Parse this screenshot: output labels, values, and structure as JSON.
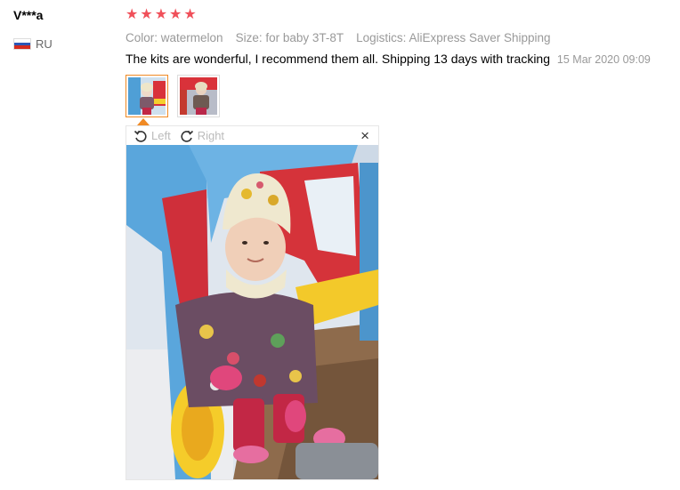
{
  "reviewer": {
    "name": "V***a",
    "country": "RU",
    "flag_icon": "russia-flag-icon"
  },
  "review": {
    "rating": 5,
    "stars": [
      "★",
      "★",
      "★",
      "★",
      "★"
    ],
    "attributes": [
      {
        "key": "Color:",
        "value": "watermelon"
      },
      {
        "key": "Size:",
        "value": "for baby 3T-8T"
      },
      {
        "key": "Logistics:",
        "value": "AliExpress Saver Shipping"
      }
    ],
    "comment": "The kits are wonderful, I recommend them all. Shipping 13 days with tracking",
    "date": "15 Mar 2020 09:09"
  },
  "viewer": {
    "rotate_left_label": "Left",
    "rotate_right_label": "Right",
    "close_symbol": "×"
  },
  "colors": {
    "star": "#f0505a",
    "active_thumb": "#f08a24",
    "muted_text": "#999999"
  }
}
